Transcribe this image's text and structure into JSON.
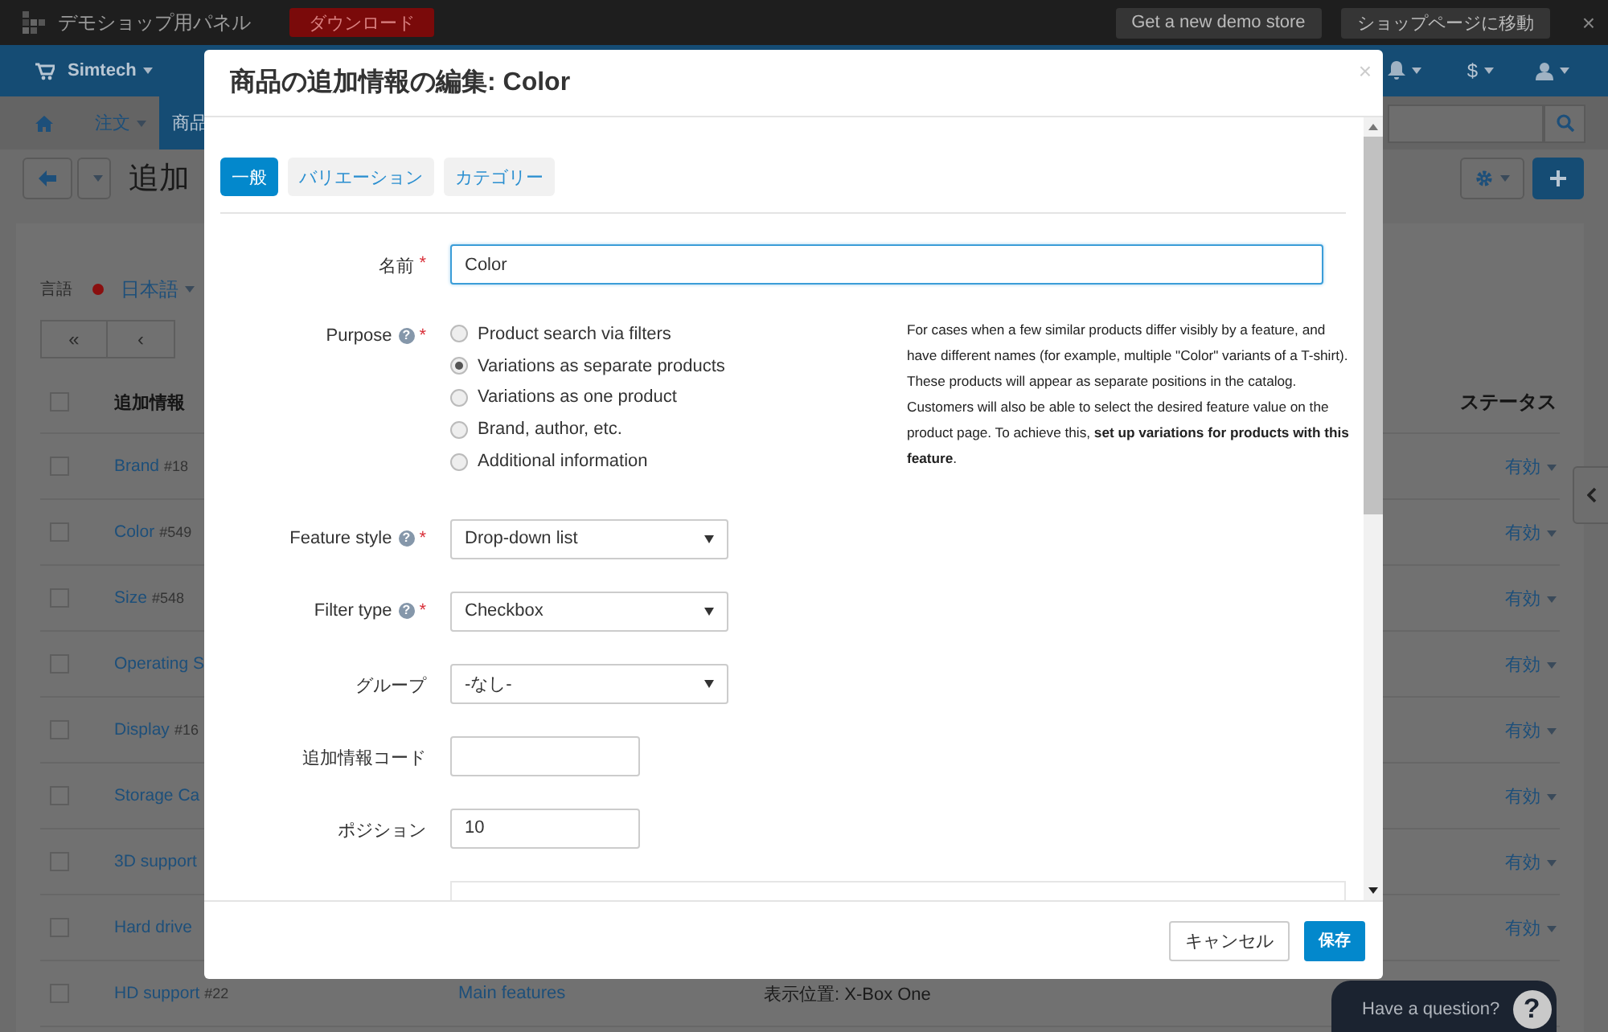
{
  "top_bar": {
    "title": "デモショップ用パネル",
    "download": "ダウンロード",
    "buttons": [
      "Get a new demo store",
      "ショップページに移動"
    ],
    "close": "×"
  },
  "nav": {
    "store": "Simtech",
    "currency": "$"
  },
  "sub_nav": [
    {
      "label": "注文",
      "selected": false
    },
    {
      "label": "商品",
      "selected": true
    }
  ],
  "page": {
    "title": "追加",
    "language_label": "言語",
    "language": "日本語",
    "pagination": [
      "«",
      "‹"
    ]
  },
  "table": {
    "columns": [
      "追加情報",
      "ステータス"
    ],
    "select_all_checked": false,
    "rows": [
      {
        "name": "Brand",
        "id": "#18",
        "status": "有効",
        "checked": false
      },
      {
        "name": "Color",
        "id": "#549",
        "status": "有効",
        "checked": false
      },
      {
        "name": "Size",
        "id": "#548",
        "status": "有効",
        "checked": false
      },
      {
        "name": "Operating S",
        "status": "有効",
        "checked": false
      },
      {
        "name": "Display",
        "id": "#16",
        "status": "有効",
        "checked": false
      },
      {
        "name": "Storage Ca",
        "status": "有効",
        "checked": false
      },
      {
        "name": "3D support",
        "status": "有効",
        "checked": false
      },
      {
        "name": "Hard drive",
        "status": "有効",
        "checked": false
      },
      {
        "name": "HD support",
        "id": "#22",
        "group": "Main features",
        "display": "表示位置: X-Box One",
        "checked": false
      }
    ]
  },
  "modal": {
    "title": "商品の追加情報の編集: Color",
    "close": "×",
    "tabs": [
      {
        "label": "一般",
        "selected": true
      },
      {
        "label": "バリエーション",
        "selected": false
      },
      {
        "label": "カテゴリー",
        "selected": false
      }
    ],
    "fields": [
      {
        "kind": "text",
        "label": "名前",
        "required": "*",
        "value": "Color",
        "focused": true
      },
      {
        "kind": "radio",
        "label": "Purpose",
        "help": "?",
        "required": "*",
        "options": [
          {
            "label": "Product search via filters",
            "selected": false
          },
          {
            "label": "Variations as separate products",
            "selected": true
          },
          {
            "label": "Variations as one product",
            "selected": false
          },
          {
            "label": "Brand, author, etc.",
            "selected": false
          },
          {
            "label": "Additional information",
            "selected": false
          }
        ],
        "note": "For cases when a few similar products differ visibly by a feature, and have different names (for example, multiple \"Color\" variants of a T-shirt). These products will appear as separate positions in the catalog. Customers will also be able to select the desired feature value on the product page. To achieve this, **set up variations for products with this feature**."
      },
      {
        "kind": "select",
        "label": "Feature style",
        "help": "?",
        "required": "*",
        "value": "Drop-down list"
      },
      {
        "kind": "select",
        "label": "Filter type",
        "help": "?",
        "required": "*",
        "value": "Checkbox"
      },
      {
        "kind": "select",
        "label": "グループ",
        "value": "-なし-"
      },
      {
        "kind": "short_text",
        "label": "追加情報コード",
        "focused": false
      },
      {
        "kind": "short_text",
        "label": "ポジション",
        "value": "10",
        "focused": false
      }
    ],
    "buttons": [
      "キャンセル",
      "保存"
    ]
  },
  "chat": {
    "label": "Have a question?",
    "icon": "?"
  }
}
